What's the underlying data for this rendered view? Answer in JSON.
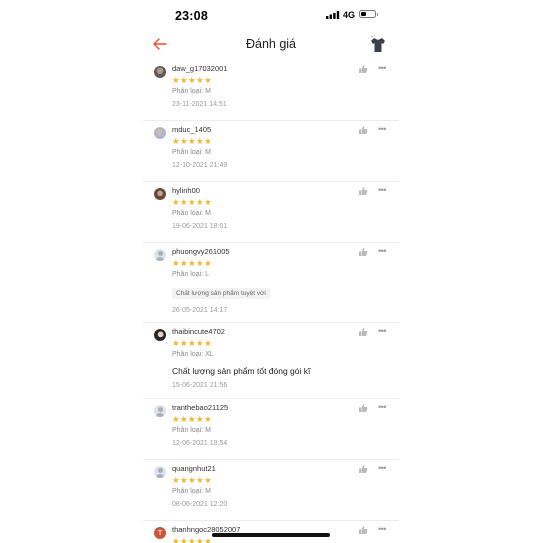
{
  "status_bar": {
    "time": "23:08",
    "network": "4G"
  },
  "header": {
    "title": "Đánh giá",
    "back_icon": "arrow-left-icon",
    "product_icon": "tshirt-icon"
  },
  "colors": {
    "accent": "#ee4d2d",
    "star": "#f0b42a"
  },
  "reviews": [
    {
      "username": "daw_g17032001",
      "stars": "★★★★★",
      "rating": 5,
      "variation": "Phân loại: M",
      "date": "23-11-2021 14:51"
    },
    {
      "username": "mduc_1405",
      "stars": "★★★★★",
      "rating": 5,
      "variation": "Phân loại: M",
      "date": "12-10-2021 21:49"
    },
    {
      "username": "hylinh00",
      "stars": "★★★★★",
      "rating": 5,
      "variation": "Phân loại: M",
      "date": "19-06-2021 18:01"
    },
    {
      "username": "phuongvy261005",
      "stars": "★★★★★",
      "rating": 5,
      "variation": "Phân loại: L",
      "tag": "Chất lượng sản phẩm tuyệt vời",
      "date": "26-05-2021 14:17"
    },
    {
      "username": "thaibincute4702",
      "stars": "★★★★★",
      "rating": 5,
      "variation": "Phân loại: XL",
      "comment": "Chất lượng sản phẩm tốt đóng gói kĩ",
      "date": "15-06-2021 21:56"
    },
    {
      "username": "tranthebao21125",
      "stars": "★★★★★",
      "rating": 5,
      "variation": "Phân loại: M",
      "date": "12-06-2021 18:54"
    },
    {
      "username": "quangnhut21",
      "stars": "★★★★★",
      "rating": 5,
      "variation": "Phân loại: M",
      "date": "08-06-2021 12:20"
    },
    {
      "username": "thanhngoc28052007",
      "avatar_letter": "T",
      "stars": "★★★★★",
      "rating": 5
    }
  ]
}
